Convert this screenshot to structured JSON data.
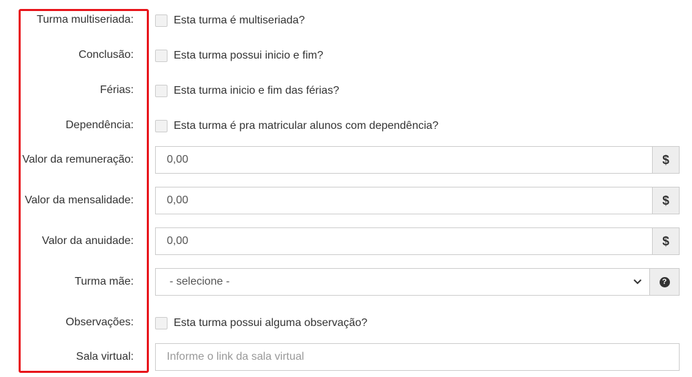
{
  "fields": {
    "multiseriada": {
      "label": "Turma multiseriada:",
      "checkbox_text": "Esta turma é multiseriada?",
      "checked": false
    },
    "conclusao": {
      "label": "Conclusão:",
      "checkbox_text": "Esta turma possui inicio e fim?",
      "checked": false
    },
    "ferias": {
      "label": "Férias:",
      "checkbox_text": "Esta turma inicio e fim das férias?",
      "checked": false
    },
    "dependencia": {
      "label": "Dependência:",
      "checkbox_text": "Esta turma é pra matricular alunos com dependência?",
      "checked": false
    },
    "remuneracao": {
      "label": "Valor da remuneração:",
      "value": "0,00",
      "addon": "$"
    },
    "mensalidade": {
      "label": "Valor da mensalidade:",
      "value": "0,00",
      "addon": "$"
    },
    "anuidade": {
      "label": "Valor da anuidade:",
      "value": "0,00",
      "addon": "$"
    },
    "turma_mae": {
      "label": "Turma mãe:",
      "selected": "- selecione -",
      "help_glyph": "?",
      "help_icon": "question-circle-icon"
    },
    "observacoes": {
      "label": "Observações:",
      "checkbox_text": "Esta turma possui alguma observação?",
      "checked": false
    },
    "sala_virtual": {
      "label": "Sala virtual:",
      "value": "",
      "placeholder": "Informe o link da sala virtual"
    }
  },
  "colors": {
    "highlight_border": "#e8151b",
    "input_border": "#cccccc",
    "addon_background": "#eeeeee"
  }
}
